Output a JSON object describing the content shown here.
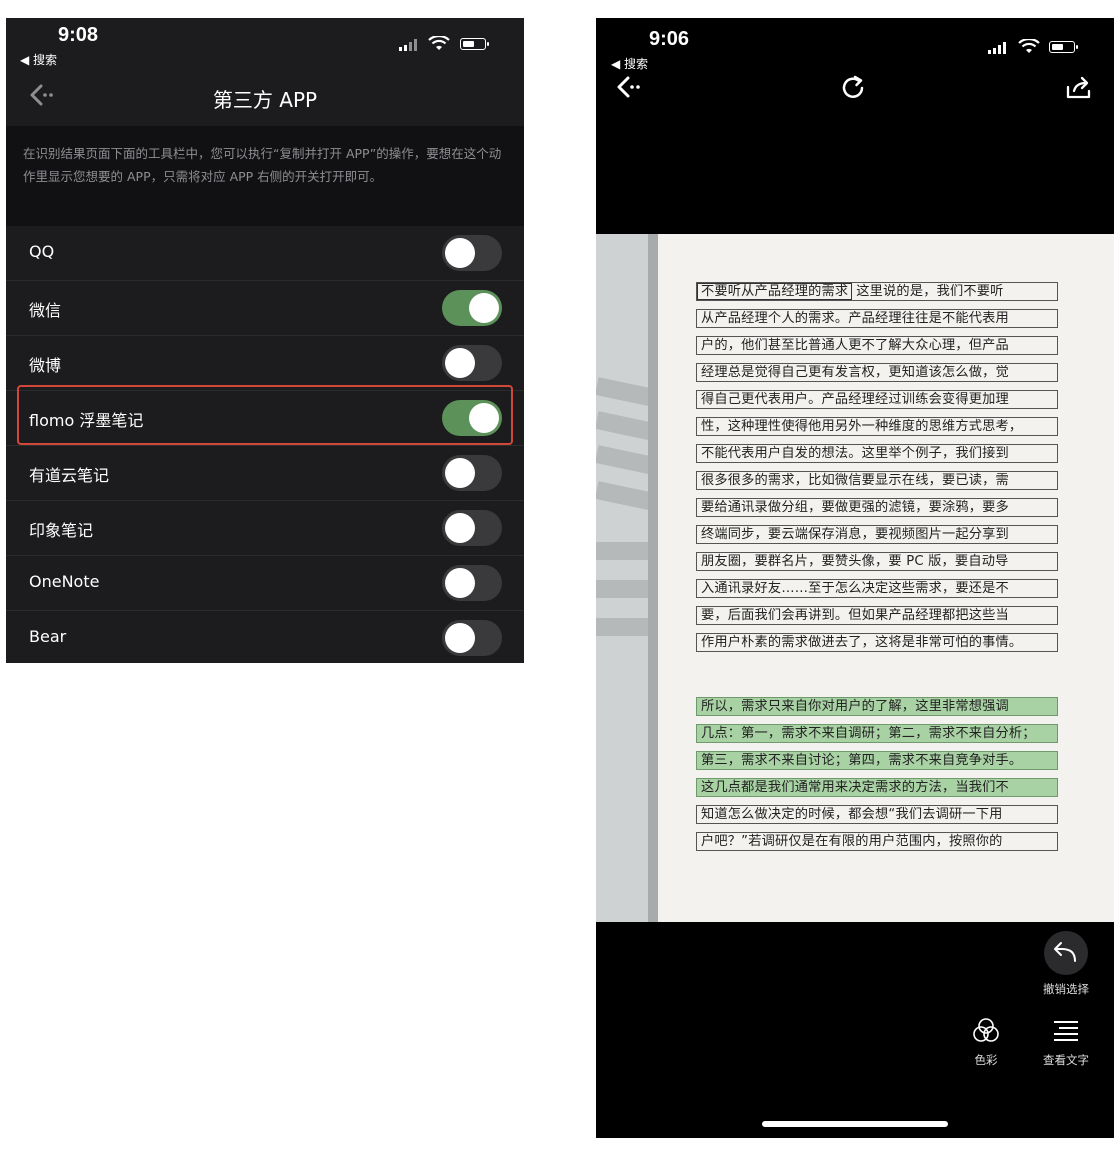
{
  "left_screen": {
    "status": {
      "time": "9:08",
      "back_app": "◀ 搜索"
    },
    "title": "第三方 APP",
    "description": "在识别结果页面下面的工具栏中，您可以执行“复制并打开 APP”的操作，要想在这个动作里显示您想要的 APP，只需将对应 APP 右侧的开关打开即可。",
    "apps": [
      {
        "label": "QQ",
        "enabled": false
      },
      {
        "label": "微信",
        "enabled": true
      },
      {
        "label": "微博",
        "enabled": false
      },
      {
        "label": "flomo 浮墨笔记",
        "enabled": true,
        "highlighted": true
      },
      {
        "label": "有道云笔记",
        "enabled": false
      },
      {
        "label": "印象笔记",
        "enabled": false
      },
      {
        "label": "OneNote",
        "enabled": false
      },
      {
        "label": "Bear",
        "enabled": false
      }
    ],
    "colors": {
      "toggle_on": "#5d915a",
      "highlight_border": "#d1483a"
    }
  },
  "right_screen": {
    "status": {
      "time": "9:06",
      "back_app": "◀ 搜索"
    },
    "icons": {
      "back": "back-arrow-icon",
      "rotate": "rotate-icon",
      "share": "share-icon"
    },
    "book_text": {
      "first_box": "不要听从产品经理的需求",
      "lines": [
        "这里说的是，我们不要听",
        "从产品经理个人的需求。产品经理往往是不能代表用",
        "户的，他们甚至比普通人更不了解大众心理，但产品",
        "经理总是觉得自己更有发言权，更知道该怎么做，觉",
        "得自己更代表用户。产品经理经过训练会变得更加理",
        "性，这种理性使得他用另外一种维度的思维方式思考，",
        "不能代表用户自发的想法。这里举个例子，我们接到",
        "很多很多的需求，比如微信要显示在线，要已读，需",
        "要给通讯录做分组，要做更强的滤镜，要涂鸦，要多",
        "终端同步，要云端保存消息，要视频图片一起分享到",
        "朋友圈，要群名片，要赞头像，要 PC 版，要自动导",
        "入通讯录好友……至于怎么决定这些需求，要还是不",
        "要，后面我们会再讲到。但如果产品经理都把这些当",
        "作用户朴素的需求做进去了，这将是非常可怕的事情。"
      ],
      "highlighted_lines": [
        "所以，需求只来自你对用户的了解，这里非常想强调",
        "几点：第一，需求不来自调研；第二，需求不来自分析；",
        "第三，需求不来自讨论；第四，需求不来自竞争对手。",
        "这几点都是我们通常用来决定需求的方法，当我们不"
      ],
      "more_lines": [
        "知道怎么做决定的时候，都会想“我们去调研一下用",
        "户吧？”若调研仅是在有限的用户范围内，按照你的"
      ]
    },
    "toolbar": {
      "undo_label": "撤销选择",
      "color_label": "色彩",
      "view_text_label": "查看文字"
    },
    "colors": {
      "highlight": "#a8d1a4"
    }
  }
}
